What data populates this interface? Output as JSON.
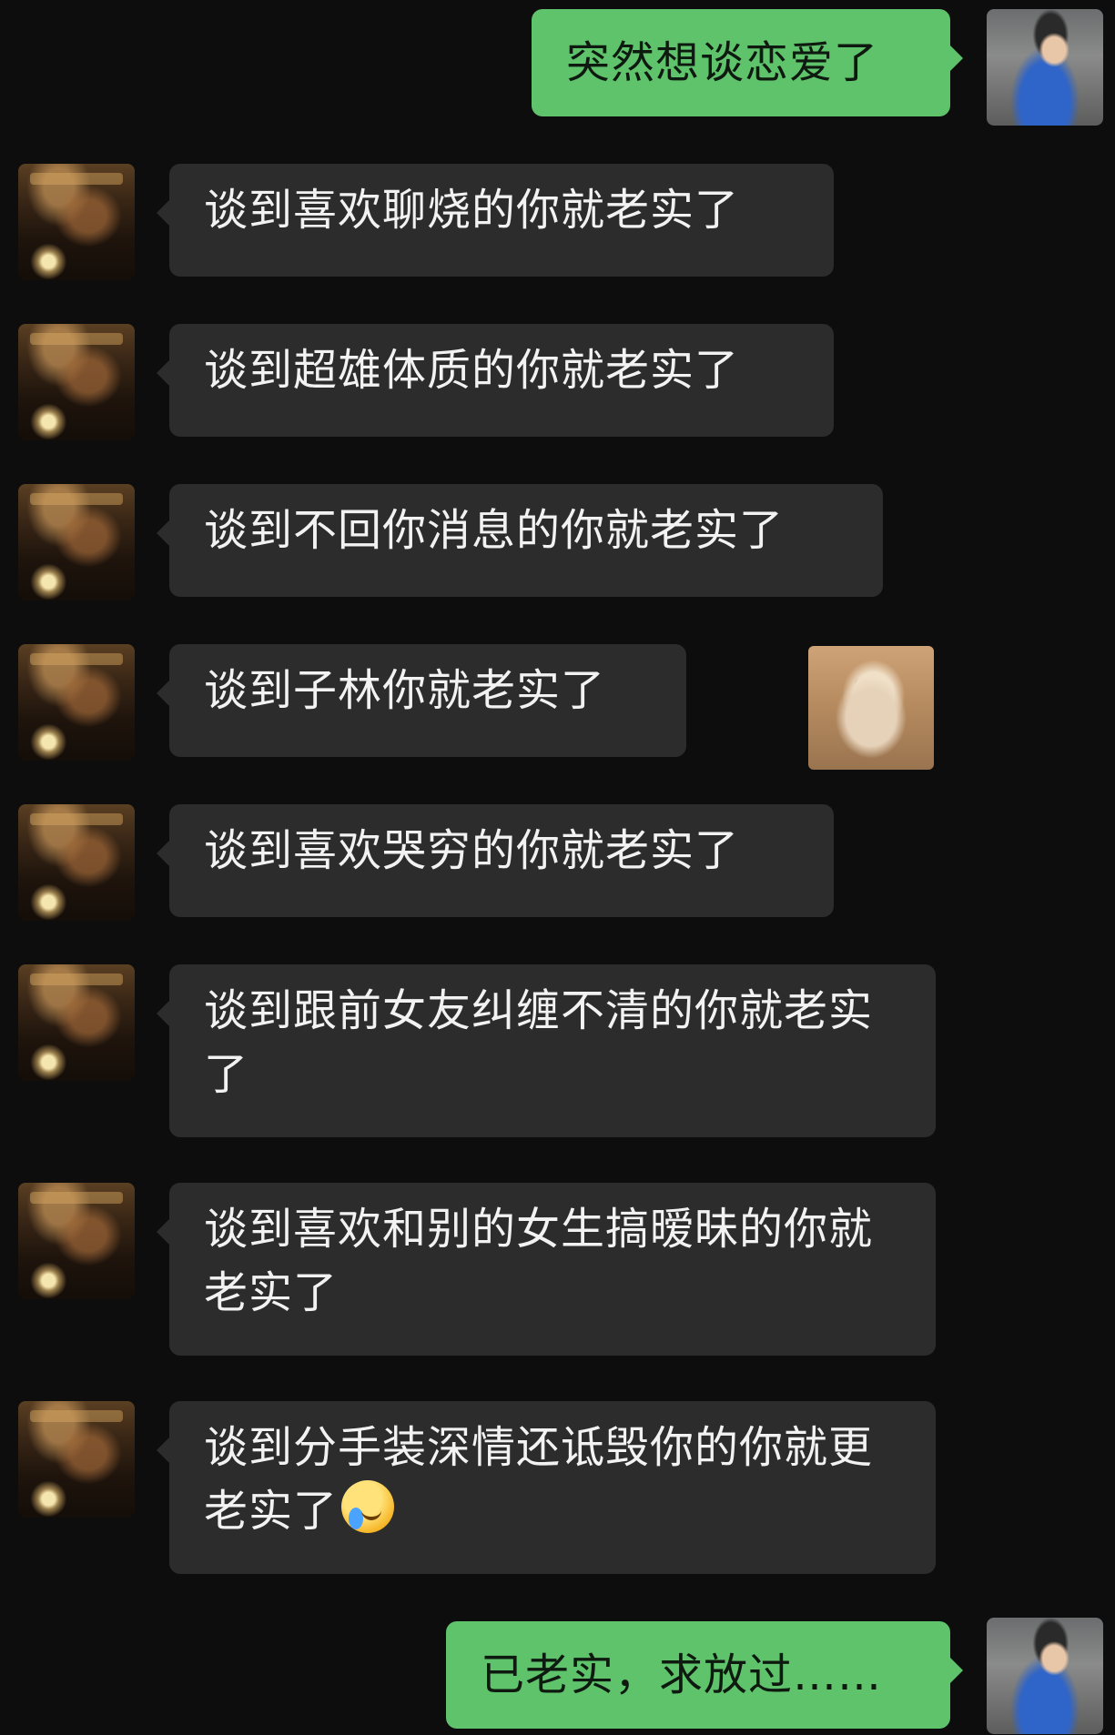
{
  "chat": {
    "messages": [
      {
        "side": "out",
        "text": "突然想谈恋爱了"
      },
      {
        "side": "in",
        "text": "谈到喜欢聊烧的你就老实了"
      },
      {
        "side": "in",
        "text": "谈到超雄体质的你就老实了"
      },
      {
        "side": "in",
        "text": "谈到不回你消息的你就老实了"
      },
      {
        "side": "in",
        "text": "谈到子林你就老实了"
      },
      {
        "side": "in",
        "text": "谈到喜欢哭穷的你就老实了"
      },
      {
        "side": "in",
        "text": "谈到跟前女友纠缠不清的你就老实了"
      },
      {
        "side": "in",
        "text": "谈到喜欢和别的女生搞暧昧的你就老实了"
      },
      {
        "side": "in",
        "text": "谈到分手装深情还诋毁你的你就更老实了",
        "emoji": "crying-laughing-emoji"
      },
      {
        "side": "out",
        "text": "已老实，求放过……"
      }
    ],
    "sticker": {
      "icon": "surprised-cat-sticker"
    }
  },
  "colors": {
    "background": "#0d0d0d",
    "incoming_bubble": "#2c2c2c",
    "outgoing_bubble": "#5fc36c"
  }
}
